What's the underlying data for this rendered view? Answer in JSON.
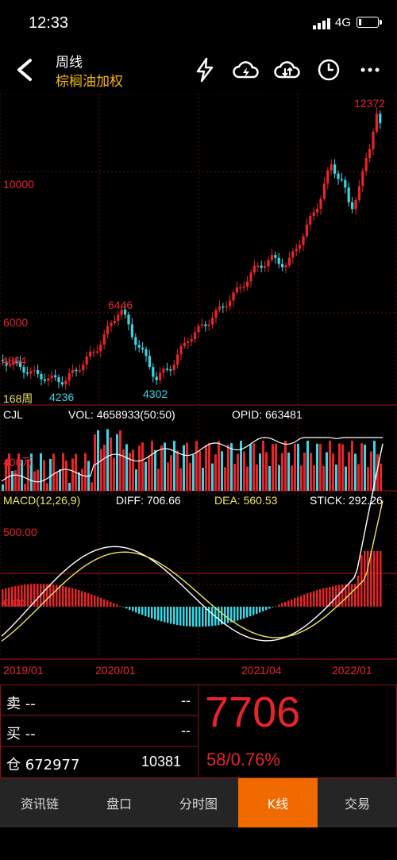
{
  "status": {
    "time": "12:33",
    "network": "4G"
  },
  "header": {
    "title": "周线",
    "subtitle": "棕榈油加权"
  },
  "icons": [
    "back-icon",
    "lightning-icon",
    "cloud-sync-icon",
    "cloud-download-icon",
    "clock-icon",
    "more-icon"
  ],
  "price_chart": {
    "period_label": "168周",
    "y_ticks": [
      "10000",
      "6000"
    ],
    "annotations": {
      "high": "12372",
      "peak_2020": "6446",
      "left_level": "4864",
      "low_2019": "4236",
      "low_2020": "4302"
    }
  },
  "volume_panel": {
    "name": "CJL",
    "vol_label": "VOL: 4658933(50:50)",
    "opid_label": "OPID: 663481",
    "y_tick": "400万"
  },
  "macd_panel": {
    "name": "MACD(12,26,9)",
    "diff_label": "DIFF: 706.66",
    "dea_label": "DEA: 560.53",
    "stick_label": "STICK: 292.26",
    "y_ticks": [
      "500.00",
      "0.00"
    ]
  },
  "x_axis": [
    "2019/01",
    "2020/01",
    "2021/04",
    "2022/01"
  ],
  "quote": {
    "sell_label": "卖 --",
    "sell_value": "--",
    "buy_label": "买 --",
    "buy_value": "--",
    "position_label": "仓 672977",
    "position_value": "10381",
    "price": "7706",
    "change": "58/0.76%"
  },
  "tabs": [
    "资讯链",
    "盘口",
    "分时图",
    "K线",
    "交易"
  ],
  "active_tab": "K线",
  "colors": {
    "up": "#e8242a",
    "down": "#39d7e6",
    "accent": "#f06a00",
    "subtitle": "#f5b800"
  },
  "chart_data": {
    "type": "candlestick",
    "period": "weekly",
    "x_ticks": [
      "2019/01",
      "2020/01",
      "2021/04",
      "2022/01"
    ],
    "y_ticks": [
      6000,
      10000
    ],
    "annotated_values": {
      "max": 12372,
      "peak_2020": 6446,
      "low_2020": 4302,
      "low_2019": 4236,
      "level": 4864
    },
    "macd": {
      "diff": 706.66,
      "dea": 560.53,
      "stick": 292.26
    },
    "volume": 4658933,
    "open_interest": 663481
  }
}
